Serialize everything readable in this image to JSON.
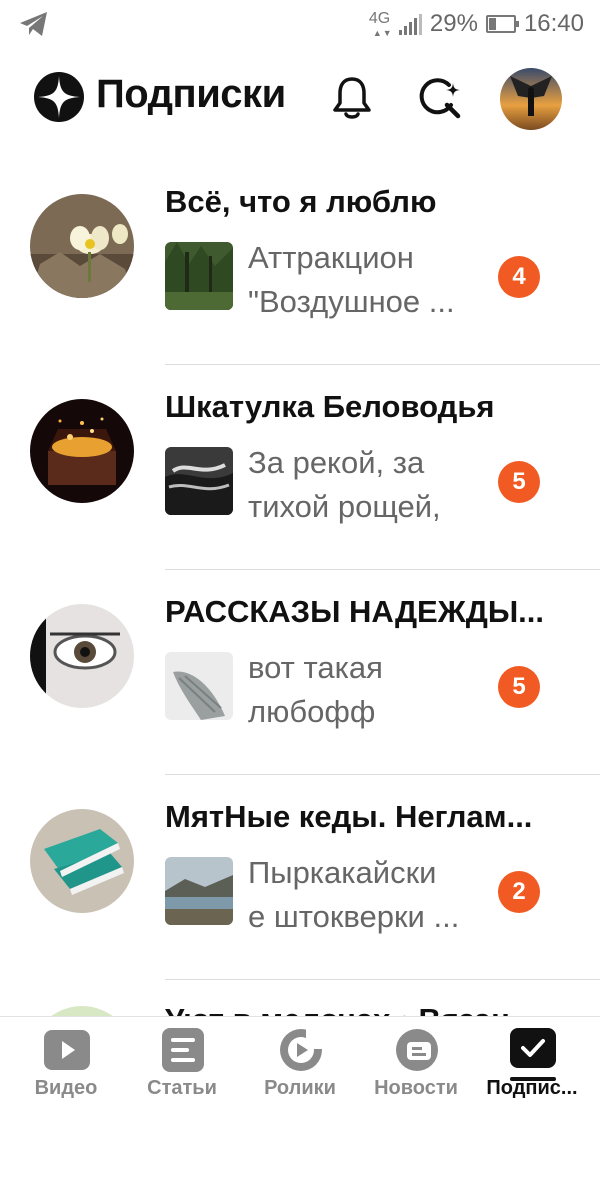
{
  "status_bar": {
    "network": "4G",
    "battery": "29%",
    "battery_level": 0.29,
    "time": "16:40"
  },
  "header": {
    "title": "Подписки"
  },
  "channels": [
    {
      "title": "Всё, что я люблю",
      "preview_line1": "Аттракцион",
      "preview_line2": "\"Воздушное ...",
      "count": "4"
    },
    {
      "title": "Шкатулка Беловодья",
      "preview_line1": "За рекой, за",
      "preview_line2": "тихой рощей,",
      "count": "5"
    },
    {
      "title": "РАССКАЗЫ НАДЕЖДЫ...",
      "preview_line1": "вот такая",
      "preview_line2": "любофф",
      "count": "5"
    },
    {
      "title": "МятНые кеды. Неглам...",
      "preview_line1": "Пыркакайски",
      "preview_line2": "е штокверки ...",
      "count": "2"
    }
  ],
  "partial_channel": {
    "title": "Уют в мелочах • Вязан"
  },
  "bottom_nav": {
    "items": [
      {
        "label": "Видео",
        "icon": "video-icon"
      },
      {
        "label": "Статьи",
        "icon": "articles-icon"
      },
      {
        "label": "Ролики",
        "icon": "shorts-icon"
      },
      {
        "label": "Новости",
        "icon": "news-icon"
      },
      {
        "label": "Подпис...",
        "icon": "subscriptions-icon"
      }
    ],
    "active_index": 4
  },
  "colors": {
    "badge": "#f15a22",
    "text_primary": "#111111",
    "text_secondary": "#666666",
    "nav_inactive": "#8a8a8a"
  }
}
